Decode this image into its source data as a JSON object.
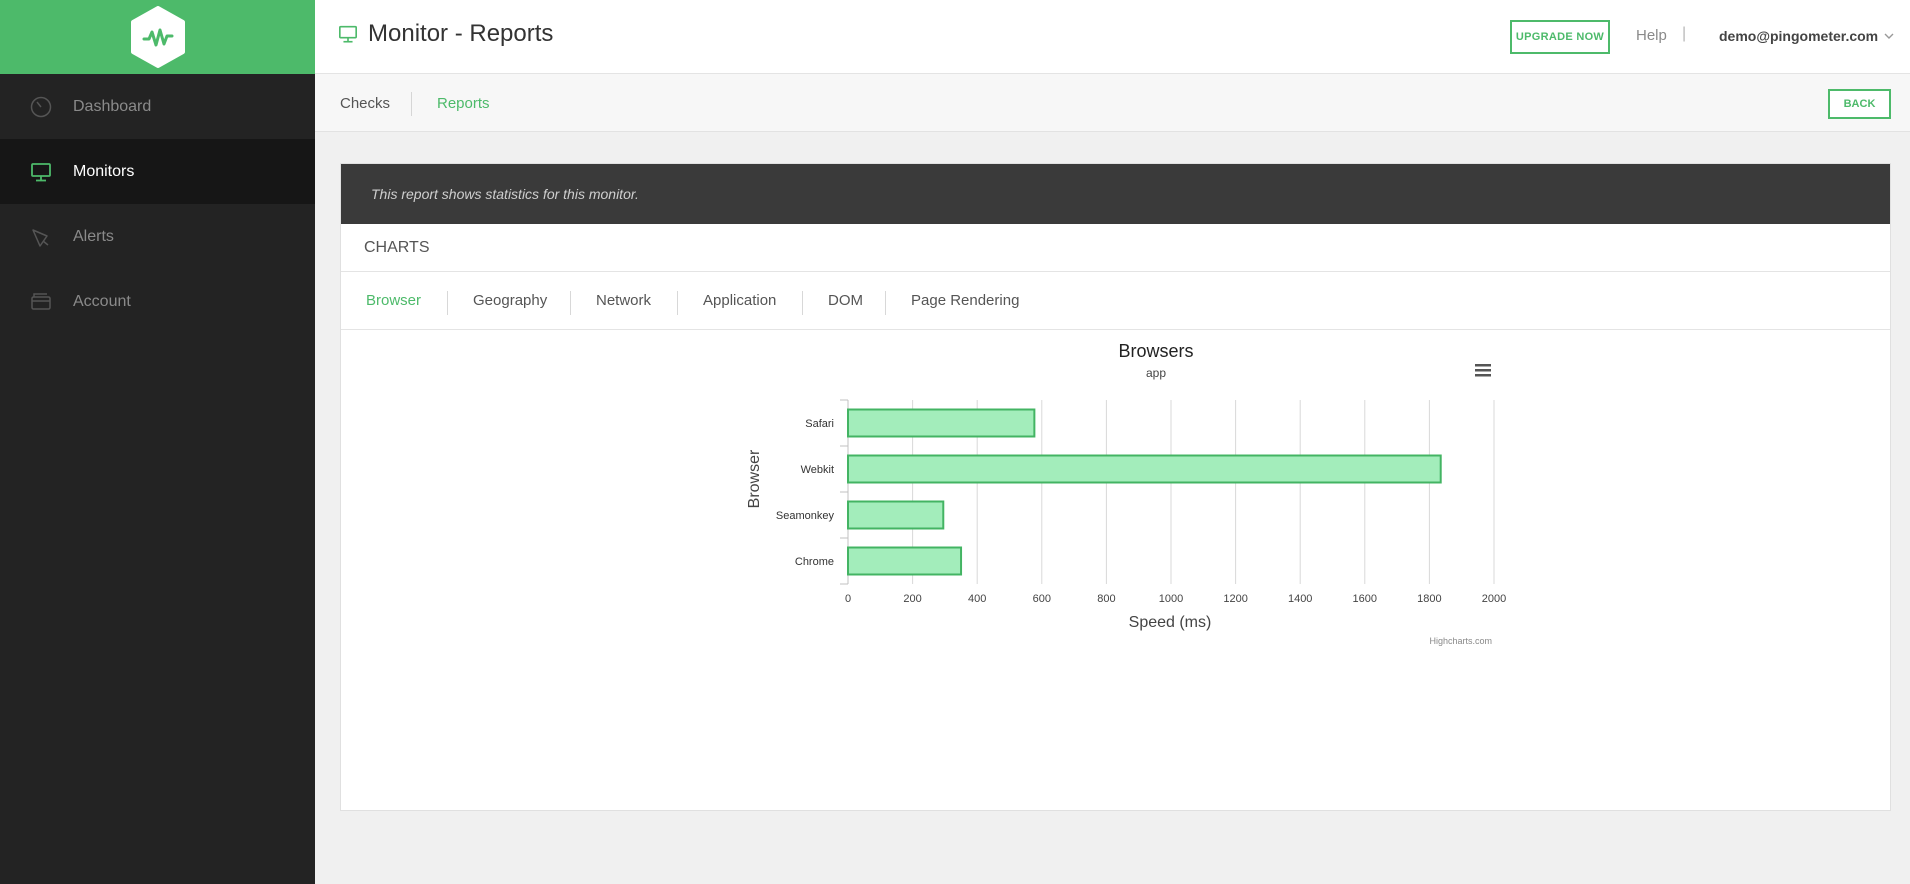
{
  "sidebar": {
    "logo_icon": "pulse-logo-icon",
    "items": [
      {
        "label": "Dashboard",
        "icon": "gauge-icon",
        "active": false
      },
      {
        "label": "Monitors",
        "icon": "monitor-icon",
        "active": true
      },
      {
        "label": "Alerts",
        "icon": "megaphone-icon",
        "active": false
      },
      {
        "label": "Account",
        "icon": "wallet-icon",
        "active": false
      }
    ]
  },
  "header": {
    "title": "Monitor - Reports",
    "upgrade_label": "UPGRADE NOW",
    "help_label": "Help",
    "separator": "|",
    "user_email": "demo@pingometer.com"
  },
  "subnav": {
    "tabs": [
      {
        "label": "Checks",
        "active": false
      },
      {
        "label": "Reports",
        "active": true
      }
    ],
    "back_label": "BACK"
  },
  "report": {
    "notice": "This report shows statistics for this monitor.",
    "charts_heading": "CHARTS",
    "tabs": [
      {
        "label": "Browser",
        "active": true
      },
      {
        "label": "Geography",
        "active": false
      },
      {
        "label": "Network",
        "active": false
      },
      {
        "label": "Application",
        "active": false
      },
      {
        "label": "DOM",
        "active": false
      },
      {
        "label": "Page Rendering",
        "active": false
      }
    ]
  },
  "colors": {
    "accent": "#4dba6a",
    "sidebar_bg": "#232323",
    "bar_fill": "#a3edbb",
    "bar_stroke": "#43b463"
  },
  "chart_data": {
    "type": "bar",
    "orientation": "horizontal",
    "title": "Browsers",
    "subtitle": "app",
    "categories": [
      "Safari",
      "Webkit",
      "Seamonkey",
      "Chrome"
    ],
    "values": [
      577,
      1835,
      295,
      350
    ],
    "xlabel": "Speed (ms)",
    "ylabel": "Browser",
    "xlim": [
      0,
      2000
    ],
    "ticks": [
      "0",
      "200",
      "400",
      "600",
      "800",
      "1000",
      "1200",
      "1400",
      "1600",
      "1800",
      "2000"
    ],
    "grid": true,
    "credits": "Highcharts.com",
    "menu_icon": "hamburger-icon"
  }
}
